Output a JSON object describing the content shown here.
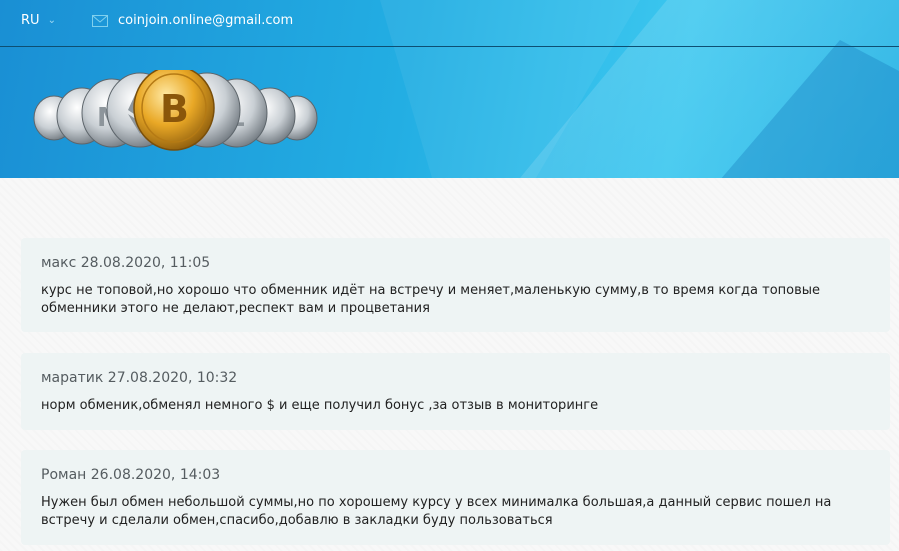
{
  "header": {
    "language": "RU",
    "email": "coinjoin.online@gmail.com",
    "icons": {
      "language_dropdown": "chevron-down-icon",
      "email": "mail-icon"
    },
    "colors": {
      "header_start": "#1a8fd4",
      "header_end": "#3cc7ef"
    }
  },
  "reviews": [
    {
      "author": "макс",
      "date": "28.08.2020, 11:05",
      "text": "курс не топовой,но хорошо что обменник идёт на встречу и меняет,маленькую сумму,в то время когда топовые обменники этого не делают,респект вам и процветания"
    },
    {
      "author": "маратик",
      "date": "27.08.2020, 10:32",
      "text": "норм обменик,обменял немного $ и еще получил бонус ,за отзыв в мониторинге"
    },
    {
      "author": "Роман",
      "date": "26.08.2020, 14:03",
      "text": "Нужен был обмен небольшой суммы,но по хорошему курсу у всех минималка большая,а данный сервис пошел на встречу и сделали обмен,спасибо,добавлю в закладки буду пользоваться"
    }
  ]
}
